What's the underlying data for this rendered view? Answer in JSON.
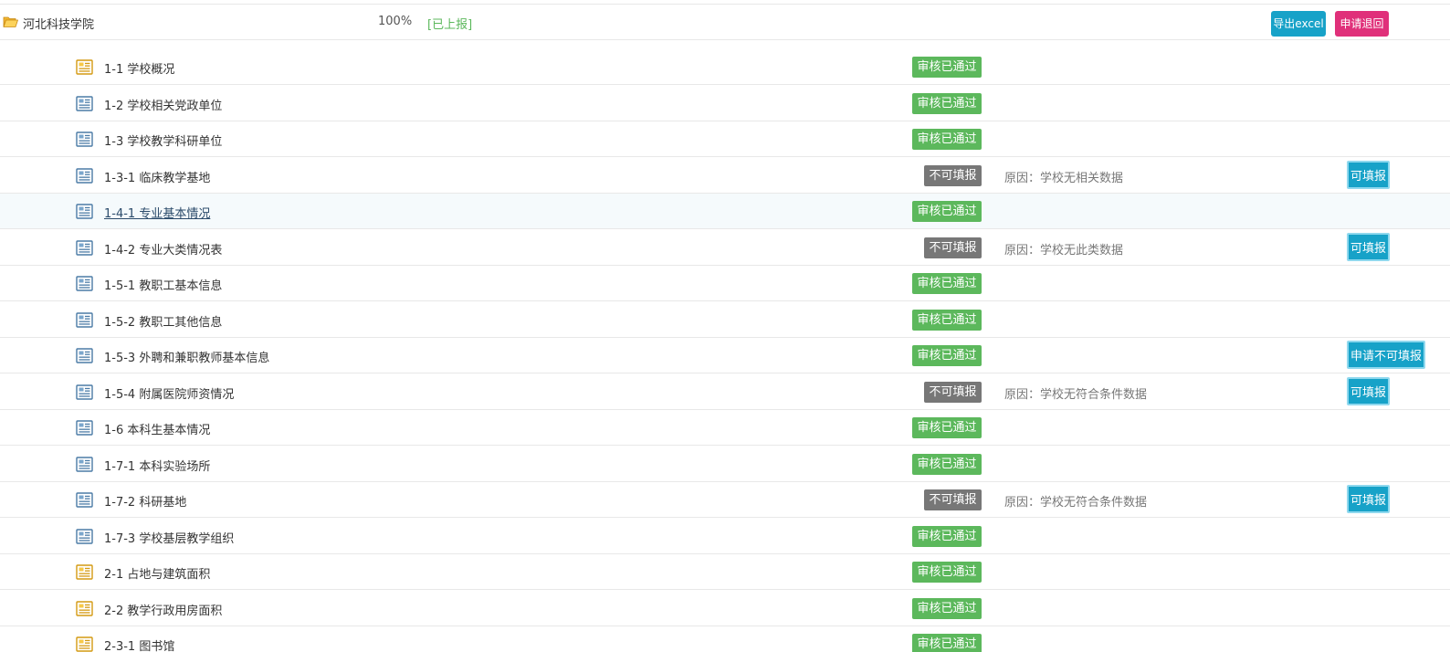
{
  "header": {
    "school_name": "河北科技学院",
    "percent": "100%",
    "status": "[已上报]",
    "export_label": "导出excel",
    "return_label": "申请退回"
  },
  "rows": [
    {
      "icon": "yellow",
      "name": "1-1 学校概况",
      "status": "审核已通过",
      "reason": "",
      "action": ""
    },
    {
      "icon": "blue",
      "name": "1-2 学校相关党政单位",
      "status": "审核已通过",
      "reason": "",
      "action": ""
    },
    {
      "icon": "blue",
      "name": "1-3 学校教学科研单位",
      "status": "审核已通过",
      "reason": "",
      "action": ""
    },
    {
      "icon": "blue",
      "name": "1-3-1 临床教学基地",
      "status": "不可填报",
      "reason": "原因：学校无相关数据",
      "action": "可填报"
    },
    {
      "icon": "blue",
      "name": "1-4-1 专业基本情况",
      "status": "审核已通过",
      "reason": "",
      "action": "",
      "link": true
    },
    {
      "icon": "blue",
      "name": "1-4-2 专业大类情况表",
      "status": "不可填报",
      "reason": "原因：学校无此类数据",
      "action": "可填报"
    },
    {
      "icon": "blue",
      "name": "1-5-1 教职工基本信息",
      "status": "审核已通过",
      "reason": "",
      "action": ""
    },
    {
      "icon": "blue",
      "name": "1-5-2 教职工其他信息",
      "status": "审核已通过",
      "reason": "",
      "action": ""
    },
    {
      "icon": "blue",
      "name": "1-5-3 外聘和兼职教师基本信息",
      "status": "审核已通过",
      "reason": "",
      "action": "申请不可填报"
    },
    {
      "icon": "blue",
      "name": "1-5-4 附属医院师资情况",
      "status": "不可填报",
      "reason": "原因：学校无符合条件数据",
      "action": "可填报"
    },
    {
      "icon": "blue",
      "name": "1-6 本科生基本情况",
      "status": "审核已通过",
      "reason": "",
      "action": ""
    },
    {
      "icon": "blue",
      "name": "1-7-1 本科实验场所",
      "status": "审核已通过",
      "reason": "",
      "action": ""
    },
    {
      "icon": "blue",
      "name": "1-7-2 科研基地",
      "status": "不可填报",
      "reason": "原因：学校无符合条件数据",
      "action": "可填报"
    },
    {
      "icon": "blue",
      "name": "1-7-3 学校基层教学组织",
      "status": "审核已通过",
      "reason": "",
      "action": ""
    },
    {
      "icon": "yellow",
      "name": "2-1 占地与建筑面积",
      "status": "审核已通过",
      "reason": "",
      "action": ""
    },
    {
      "icon": "yellow",
      "name": "2-2 教学行政用房面积",
      "status": "审核已通过",
      "reason": "",
      "action": ""
    },
    {
      "icon": "yellow",
      "name": "2-3-1 图书馆",
      "status": "审核已通过",
      "reason": "",
      "action": ""
    }
  ],
  "colors": {
    "pass": "#5cb85c",
    "no": "#777777",
    "action": "#17a2c8",
    "return": "#e0307a"
  }
}
